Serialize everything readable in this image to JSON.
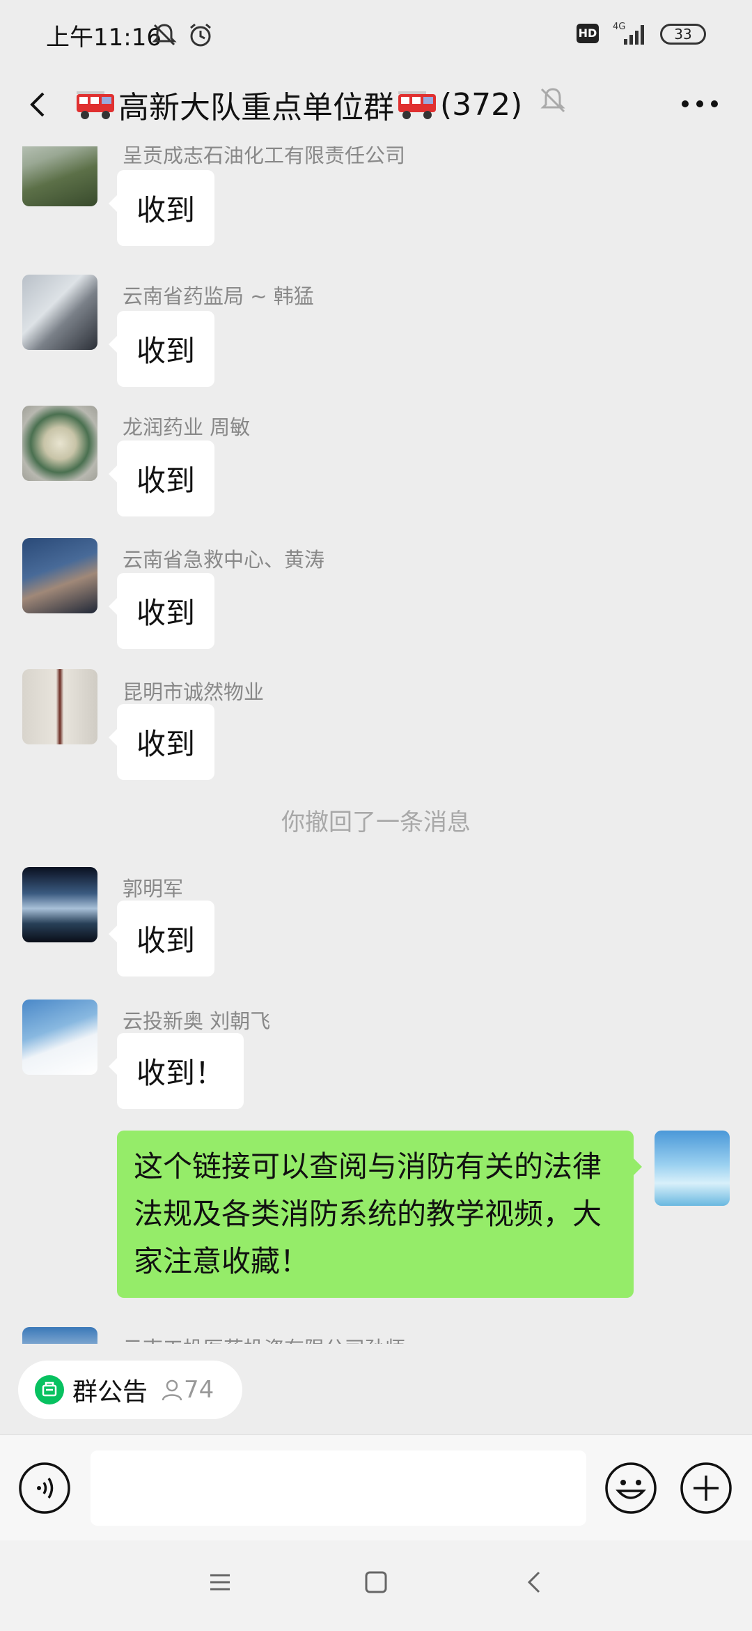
{
  "status_bar": {
    "time": "上午11:16",
    "network": "4G",
    "battery": "33"
  },
  "header": {
    "title": "高新大队重点单位群",
    "member_count": "(372)"
  },
  "messages": [
    {
      "sender": "呈贡成志石油化工有限责任公司",
      "text": "收到"
    },
    {
      "sender": "云南省药监局 ~ 韩猛",
      "text": "收到"
    },
    {
      "sender": "龙润药业   周敏",
      "text": "收到"
    },
    {
      "sender": "云南省急救中心、黄涛",
      "text": "收到"
    },
    {
      "sender": "昆明市诚然物业",
      "text": "收到"
    },
    {
      "sender": "郭明军",
      "text": "收到"
    },
    {
      "sender": "云投新奥 刘朝飞",
      "text": "收到！"
    },
    {
      "sender": "云南工投医药投资有限公司孙师",
      "text": ""
    }
  ],
  "system_message": "你撤回了一条消息",
  "my_message": "这个链接可以查阅与消防有关的法律法规及各类消防系统的教学视频，大家注意收藏！",
  "notice": {
    "label": "群公告",
    "count": "74"
  },
  "input": {
    "value": ""
  },
  "colors": {
    "background": "#ededed",
    "my_bubble": "#95ec69",
    "other_bubble": "#ffffff",
    "notice_icon": "#07c160"
  },
  "icons": [
    "back-icon",
    "fire-truck-icon",
    "mute-bell-icon",
    "more-icon",
    "voice-icon",
    "emoji-icon",
    "plus-icon",
    "notice-icon",
    "person-icon"
  ]
}
